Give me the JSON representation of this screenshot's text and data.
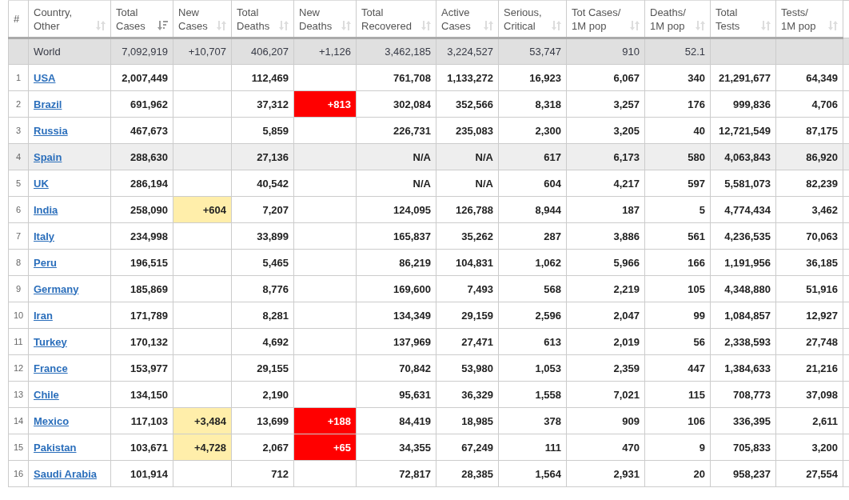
{
  "table": {
    "columns": [
      {
        "kind": "index",
        "label": "#"
      },
      {
        "kind": "name",
        "label": "Country, Other",
        "sorted": false
      },
      {
        "kind": "number",
        "label": "Total Cases",
        "sorted": true
      },
      {
        "kind": "new_cases",
        "label": "New Cases",
        "sorted": false
      },
      {
        "kind": "number",
        "label": "Total Deaths",
        "sorted": false
      },
      {
        "kind": "new_deaths",
        "label": "New Deaths",
        "sorted": false
      },
      {
        "kind": "number",
        "label": "Total Recovered",
        "sorted": false
      },
      {
        "kind": "number",
        "label": "Active Cases",
        "sorted": false
      },
      {
        "kind": "number",
        "label": "Serious, Critical",
        "sorted": false
      },
      {
        "kind": "number",
        "label": "Tot Cases/ 1M pop",
        "sorted": false
      },
      {
        "kind": "number",
        "label": "Deaths/ 1M pop",
        "sorted": false
      },
      {
        "kind": "number",
        "label": "Total Tests",
        "sorted": false
      },
      {
        "kind": "number",
        "label": "Tests/ 1M pop",
        "sorted": false
      }
    ],
    "world": {
      "cells": [
        null,
        "World",
        "7,092,919",
        "+10,707",
        "406,207",
        "+1,126",
        "3,462,185",
        "3,224,527",
        "53,747",
        "910",
        "52.1",
        null,
        null
      ]
    },
    "rows": [
      {
        "highlighted": false,
        "cells": [
          "1",
          "USA",
          "2,007,449",
          null,
          "112,469",
          null,
          "761,708",
          "1,133,272",
          "16,923",
          "6,067",
          "340",
          "21,291,677",
          "64,349"
        ]
      },
      {
        "highlighted": false,
        "cells": [
          "2",
          "Brazil",
          "691,962",
          null,
          "37,312",
          "+813",
          "302,084",
          "352,566",
          "8,318",
          "3,257",
          "176",
          "999,836",
          "4,706"
        ]
      },
      {
        "highlighted": false,
        "cells": [
          "3",
          "Russia",
          "467,673",
          null,
          "5,859",
          null,
          "226,731",
          "235,083",
          "2,300",
          "3,205",
          "40",
          "12,721,549",
          "87,175"
        ]
      },
      {
        "highlighted": true,
        "cells": [
          "4",
          "Spain",
          "288,630",
          null,
          "27,136",
          null,
          "N/A",
          "N/A",
          "617",
          "6,173",
          "580",
          "4,063,843",
          "86,920"
        ]
      },
      {
        "highlighted": false,
        "cells": [
          "5",
          "UK",
          "286,194",
          null,
          "40,542",
          null,
          "N/A",
          "N/A",
          "604",
          "4,217",
          "597",
          "5,581,073",
          "82,239"
        ]
      },
      {
        "highlighted": false,
        "cells": [
          "6",
          "India",
          "258,090",
          "+604",
          "7,207",
          null,
          "124,095",
          "126,788",
          "8,944",
          "187",
          "5",
          "4,774,434",
          "3,462"
        ]
      },
      {
        "highlighted": false,
        "cells": [
          "7",
          "Italy",
          "234,998",
          null,
          "33,899",
          null,
          "165,837",
          "35,262",
          "287",
          "3,886",
          "561",
          "4,236,535",
          "70,063"
        ]
      },
      {
        "highlighted": false,
        "cells": [
          "8",
          "Peru",
          "196,515",
          null,
          "5,465",
          null,
          "86,219",
          "104,831",
          "1,062",
          "5,966",
          "166",
          "1,191,956",
          "36,185"
        ]
      },
      {
        "highlighted": false,
        "cells": [
          "9",
          "Germany",
          "185,869",
          null,
          "8,776",
          null,
          "169,600",
          "7,493",
          "568",
          "2,219",
          "105",
          "4,348,880",
          "51,916"
        ]
      },
      {
        "highlighted": false,
        "cells": [
          "10",
          "Iran",
          "171,789",
          null,
          "8,281",
          null,
          "134,349",
          "29,159",
          "2,596",
          "2,047",
          "99",
          "1,084,857",
          "12,927"
        ]
      },
      {
        "highlighted": false,
        "cells": [
          "11",
          "Turkey",
          "170,132",
          null,
          "4,692",
          null,
          "137,969",
          "27,471",
          "613",
          "2,019",
          "56",
          "2,338,593",
          "27,748"
        ]
      },
      {
        "highlighted": false,
        "cells": [
          "12",
          "France",
          "153,977",
          null,
          "29,155",
          null,
          "70,842",
          "53,980",
          "1,053",
          "2,359",
          "447",
          "1,384,633",
          "21,216"
        ]
      },
      {
        "highlighted": false,
        "cells": [
          "13",
          "Chile",
          "134,150",
          null,
          "2,190",
          null,
          "95,631",
          "36,329",
          "1,558",
          "7,021",
          "115",
          "708,773",
          "37,098"
        ]
      },
      {
        "highlighted": false,
        "cells": [
          "14",
          "Mexico",
          "117,103",
          "+3,484",
          "13,699",
          "+188",
          "84,419",
          "18,985",
          "378",
          "909",
          "106",
          "336,395",
          "2,611"
        ]
      },
      {
        "highlighted": false,
        "cells": [
          "15",
          "Pakistan",
          "103,671",
          "+4,728",
          "2,067",
          "+65",
          "34,355",
          "67,249",
          "111",
          "470",
          "9",
          "705,833",
          "3,200"
        ]
      },
      {
        "highlighted": false,
        "cells": [
          "16",
          "Saudi Arabia",
          "101,914",
          null,
          "712",
          null,
          "72,817",
          "28,385",
          "1,564",
          "2,931",
          "20",
          "958,237",
          "27,554"
        ]
      }
    ]
  }
}
